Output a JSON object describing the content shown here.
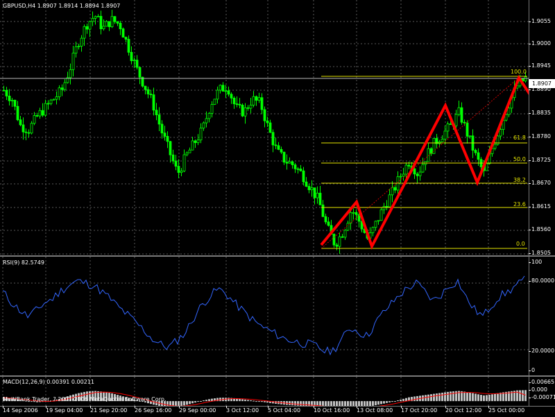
{
  "header": {
    "symbol_ohlc": "GBPUSD,H4  1.8907 1.8914 1.8894 1.8907"
  },
  "price_scale": [
    "1.9055",
    "1.9000",
    "1.8945",
    "1.8890",
    "1.8835",
    "1.8780",
    "1.8725",
    "1.8670",
    "1.8615",
    "1.8560",
    "1.8505"
  ],
  "current_price": "1.8907",
  "fibonacci_levels": [
    "100.0",
    "61.8",
    "50.0",
    "38.2",
    "23.6",
    "0.0"
  ],
  "rsi": {
    "label": "RSI(9) 82.5749",
    "scale": [
      "100",
      "80.0000",
      "20.0000",
      "0"
    ]
  },
  "macd": {
    "label": "MACD(12,26,9) 0.00391 0.00211",
    "scale": [
      "0.00665",
      "0.000",
      "-0.00071"
    ]
  },
  "footer": {
    "copyright": "MultiBank Trader, ? 2001-2006 MetaQuotes Software Corp."
  },
  "time_axis": [
    "14 Sep 2006",
    "19 Sep 04:00",
    "21 Sep 20:00",
    "26 Sep 16:00",
    "29 Sep 00:00",
    "3 Oct 12:00",
    "5 Oct 04:00",
    "10 Oct 16:00",
    "13 Oct 08:00",
    "17 Oct 20:00",
    "20 Oct 12:00",
    "25 Oct 00:00"
  ],
  "colors": {
    "candles": "#00ff00",
    "rsi_line": "#3366ff",
    "fibo": "#e6e600",
    "pattern": "#ff0000",
    "macd_hist": "#c0c0c0",
    "macd_signal": "#ff0000",
    "grid": "#5a5a5a"
  },
  "chart_data": [
    {
      "type": "candlestick",
      "title": "GBPUSD,H4",
      "ylim": [
        1.8505,
        1.9085
      ],
      "close_path": [
        1.888,
        1.886,
        1.88,
        1.879,
        1.882,
        1.884,
        1.886,
        1.888,
        1.893,
        1.899,
        1.903,
        1.905,
        1.902,
        1.904,
        1.903,
        1.898,
        1.893,
        1.889,
        1.885,
        1.879,
        1.874,
        1.869,
        1.873,
        1.876,
        1.879,
        1.885,
        1.888,
        1.889,
        1.884,
        1.883,
        1.886,
        1.885,
        1.879,
        1.874,
        1.872,
        1.871,
        1.869,
        1.866,
        1.863,
        1.857,
        1.853,
        1.856,
        1.861,
        1.858,
        1.854,
        1.858,
        1.862,
        1.865,
        1.869,
        1.872,
        1.869,
        1.873,
        1.876,
        1.878,
        1.88,
        1.883,
        1.878,
        1.873,
        1.869,
        1.875,
        1.88,
        1.885,
        1.889,
        1.8907
      ]
    },
    {
      "type": "line",
      "title": "RSI(9)",
      "ylim": [
        0,
        100
      ],
      "values": [
        72,
        63,
        56,
        50,
        55,
        62,
        66,
        73,
        78,
        82,
        80,
        78,
        72,
        66,
        58,
        52,
        45,
        38,
        30,
        25,
        22,
        28,
        35,
        48,
        60,
        68,
        75,
        70,
        62,
        55,
        48,
        42,
        38,
        34,
        30,
        28,
        26,
        25,
        23,
        18,
        20,
        30,
        40,
        36,
        32,
        44,
        54,
        62,
        70,
        76,
        80,
        72,
        64,
        70,
        78,
        82,
        66,
        56,
        50,
        60,
        68,
        72,
        78,
        82.57
      ]
    },
    {
      "type": "bar",
      "title": "MACD(12,26,9)",
      "ylim": [
        -0.00071,
        0.00665
      ],
      "values": [
        0.0015,
        0.001,
        0.0004,
        0.0,
        -0.0004,
        -0.0002,
        0.0003,
        0.001,
        0.002,
        0.0028,
        0.0034,
        0.0036,
        0.0033,
        0.0028,
        0.002,
        0.0012,
        0.0004,
        -0.0004,
        -0.0012,
        -0.0018,
        -0.0022,
        -0.002,
        -0.0014,
        -0.0006,
        0.0002,
        0.0008,
        0.0012,
        0.0012,
        0.001,
        0.0006,
        0.0002,
        -0.0002,
        -0.0006,
        -0.001,
        -0.0013,
        -0.0015,
        -0.0017,
        -0.0019,
        -0.0022,
        -0.0026,
        -0.003,
        -0.0029,
        -0.0025,
        -0.0022,
        -0.002,
        -0.0014,
        -0.0008,
        -0.0002,
        0.0006,
        0.0014,
        0.0018,
        0.0022,
        0.0026,
        0.003,
        0.0034,
        0.0036,
        0.0032,
        0.0026,
        0.002,
        0.0024,
        0.003,
        0.0034,
        0.0038,
        0.0039
      ],
      "signal": [
        0.0012,
        0.001,
        0.0007,
        0.0004,
        0.0001,
        -0.0001,
        0.0,
        0.0004,
        0.001,
        0.0017,
        0.0024,
        0.003,
        0.0032,
        0.0031,
        0.0027,
        0.0021,
        0.0014,
        0.0006,
        -0.0002,
        -0.0009,
        -0.0015,
        -0.0018,
        -0.0017,
        -0.0013,
        -0.0007,
        -0.0001,
        0.0004,
        0.0008,
        0.0009,
        0.0008,
        0.0006,
        0.0003,
        0.0,
        -0.0004,
        -0.0007,
        -0.001,
        -0.0012,
        -0.0014,
        -0.0016,
        -0.0019,
        -0.0022,
        -0.0024,
        -0.0024,
        -0.0023,
        -0.0022,
        -0.0019,
        -0.0015,
        -0.001,
        -0.0004,
        0.0002,
        0.0008,
        0.0013,
        0.0018,
        0.0022,
        0.0026,
        0.003,
        0.0031,
        0.003,
        0.0027,
        0.0026,
        0.0027,
        0.0029,
        0.0032,
        0.0021
      ]
    }
  ]
}
